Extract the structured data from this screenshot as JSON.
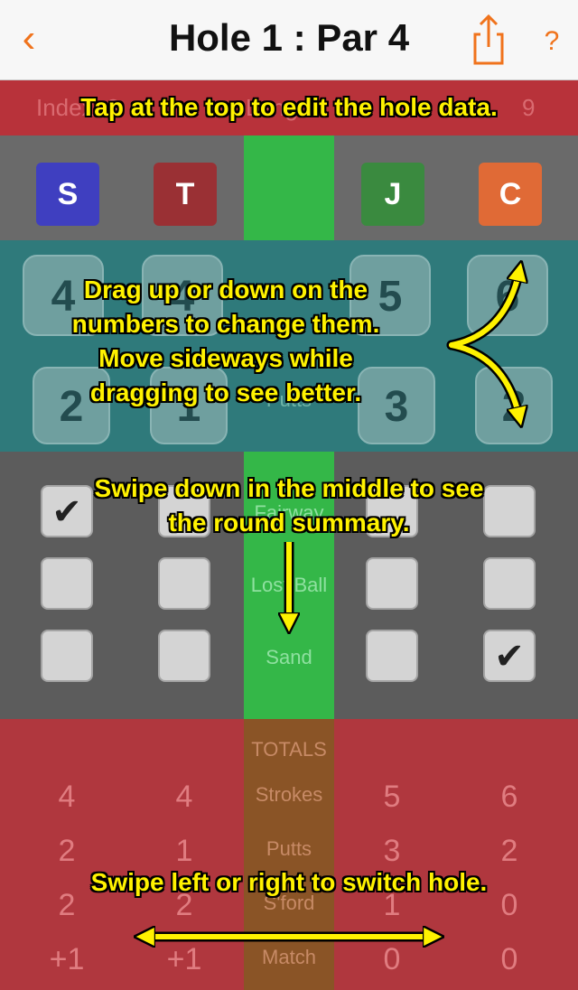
{
  "nav": {
    "back_icon": "chevron-left-icon",
    "title": "Hole 1 : Par 4",
    "share_icon": "share-icon",
    "help_label": "?"
  },
  "hole_info": {
    "index_label": "Index: 3",
    "length_label": "Length:",
    "extra_label": "9"
  },
  "players": [
    {
      "initial": "S",
      "color": "#3f3fc0"
    },
    {
      "initial": "T",
      "color": "#9a3034"
    },
    {
      "initial": "J",
      "color": "#3a8a3f"
    },
    {
      "initial": "C",
      "color": "#e06a36"
    }
  ],
  "strokes": [
    "4",
    "4",
    "5",
    "6"
  ],
  "putts": [
    "2",
    "1",
    "3",
    "2"
  ],
  "stat_labels": {
    "putts": "Putts",
    "fairway": "Fairway",
    "lost_ball": "Lost Ball",
    "sand": "Sand"
  },
  "checkboxes": {
    "fairway": [
      true,
      false,
      false,
      false
    ],
    "lost_ball": [
      false,
      false,
      false,
      false
    ],
    "sand": [
      false,
      false,
      false,
      true
    ]
  },
  "check_mark": "✔",
  "totals": {
    "header": "TOTALS",
    "strokes_label": "Strokes",
    "putts_label": "Putts",
    "stableford_label": "S'ford",
    "match_label": "Match",
    "strokes": [
      "4",
      "4",
      "5",
      "6"
    ],
    "putts": [
      "2",
      "1",
      "3",
      "2"
    ],
    "stableford": [
      "2",
      "2",
      "1",
      "0"
    ],
    "match": [
      "+1",
      "+1",
      "0",
      "0"
    ]
  },
  "hints": {
    "top": "Tap at the top to edit the hole data.",
    "drag": "Drag up or down on the numbers to change them. Move sideways while dragging to see better.",
    "swipe_down": "Swipe down in the middle to see the round summary.",
    "swipe_side": "Swipe left or right to switch hole."
  }
}
